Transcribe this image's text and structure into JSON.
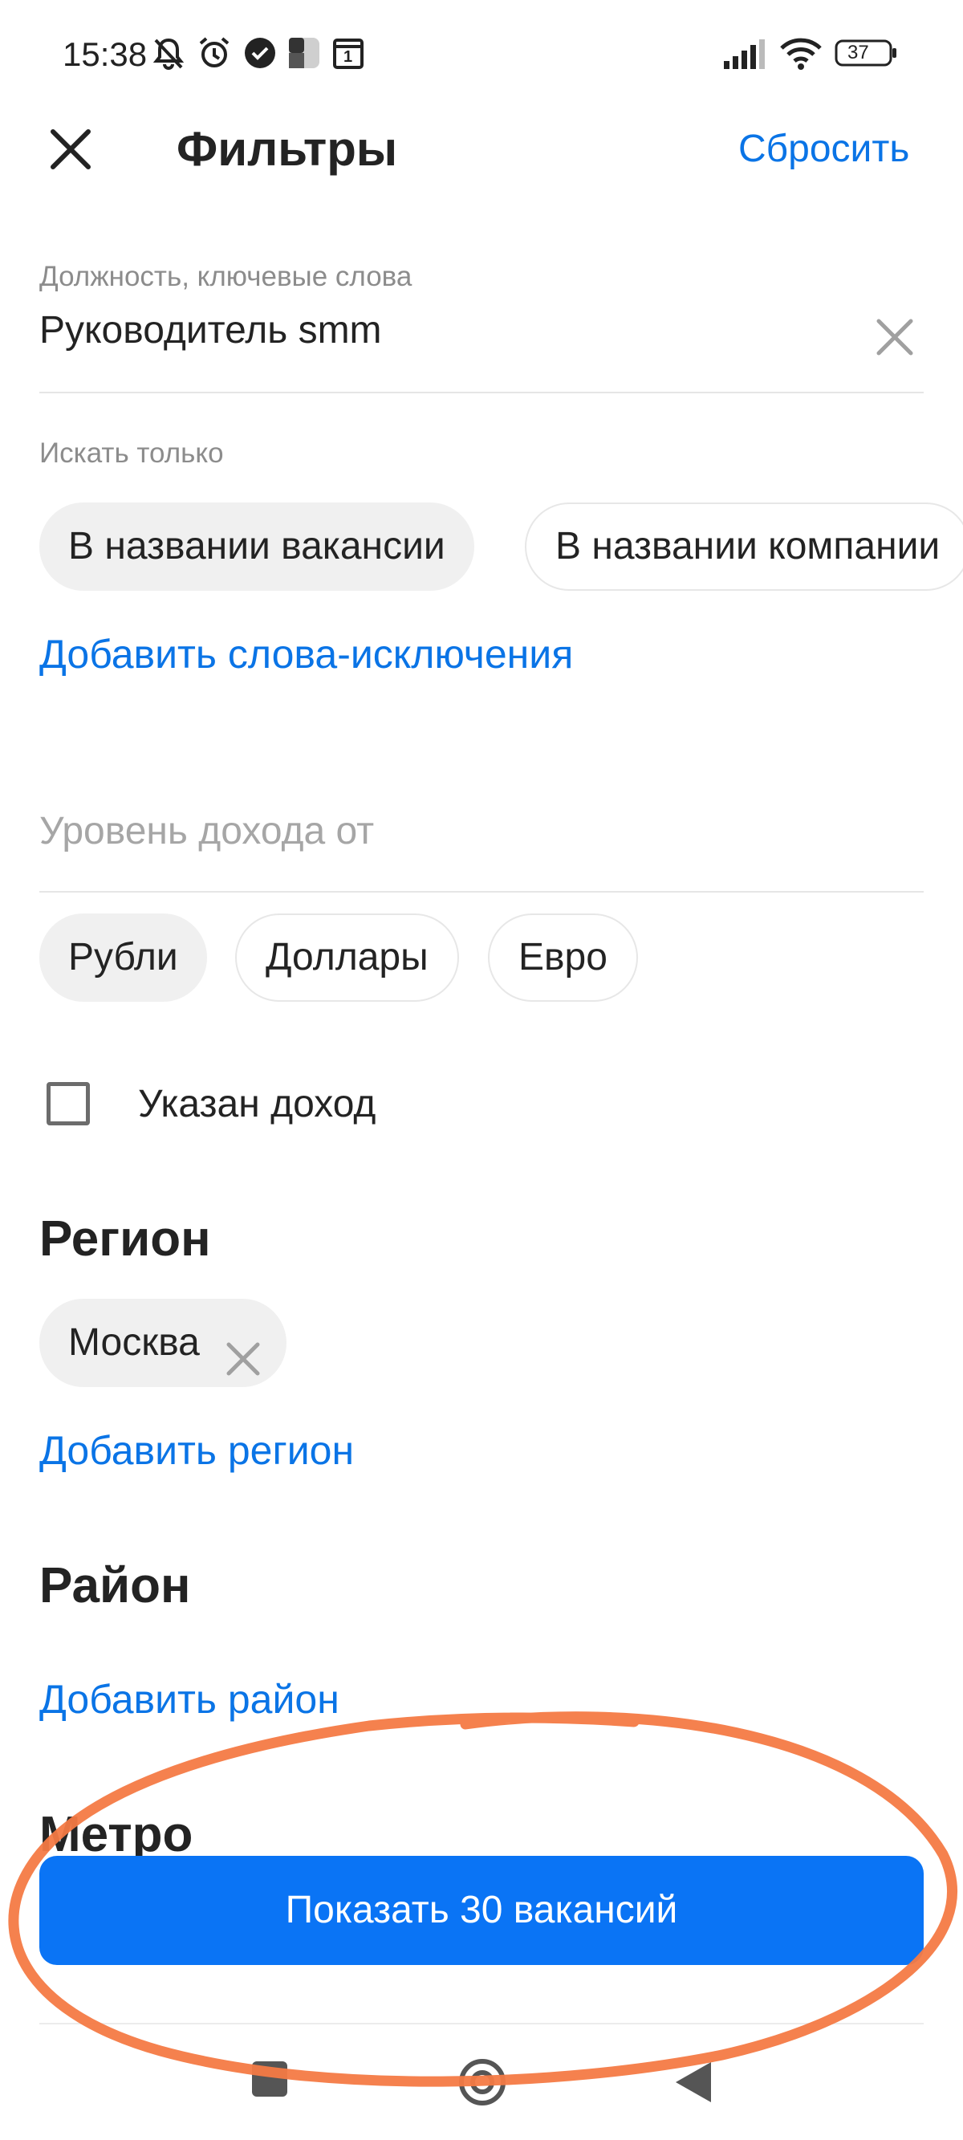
{
  "status_bar": {
    "time": "15:38",
    "battery": "37",
    "icons": [
      "bell-off-icon",
      "alarm-icon",
      "check-circle-icon",
      "app-icon",
      "calendar-icon",
      "signal-icon",
      "wifi-icon",
      "battery-icon"
    ],
    "calendar_day": "1"
  },
  "header": {
    "close_icon": "close-icon",
    "title": "Фильтры",
    "reset_label": "Сбросить"
  },
  "position_field": {
    "label": "Должность, ключевые слова",
    "value": "Руководитель smm",
    "clear_icon": "close-icon"
  },
  "search_only": {
    "label": "Искать только",
    "chips": [
      {
        "label": "В названии вакансии",
        "selected": true
      },
      {
        "label": "В названии компании",
        "selected": false
      }
    ],
    "add_exclusions_link": "Добавить слова-исключения"
  },
  "income": {
    "placeholder": "Уровень дохода от",
    "currencies": [
      {
        "label": "Рубли",
        "selected": true
      },
      {
        "label": "Доллары",
        "selected": false
      },
      {
        "label": "Евро",
        "selected": false
      }
    ],
    "checkbox_label": "Указан доход",
    "checkbox_checked": false
  },
  "region": {
    "heading": "Регион",
    "chips": [
      {
        "label": "Москва"
      }
    ],
    "add_link": "Добавить регион"
  },
  "district": {
    "heading": "Район",
    "add_link": "Добавить район"
  },
  "metro": {
    "heading": "Метро"
  },
  "footer": {
    "show_button": "Показать 30 вакансий"
  },
  "colors": {
    "accent": "#0a74e6",
    "button": "#0a74f5",
    "annotation_stroke": "#f47a45"
  }
}
